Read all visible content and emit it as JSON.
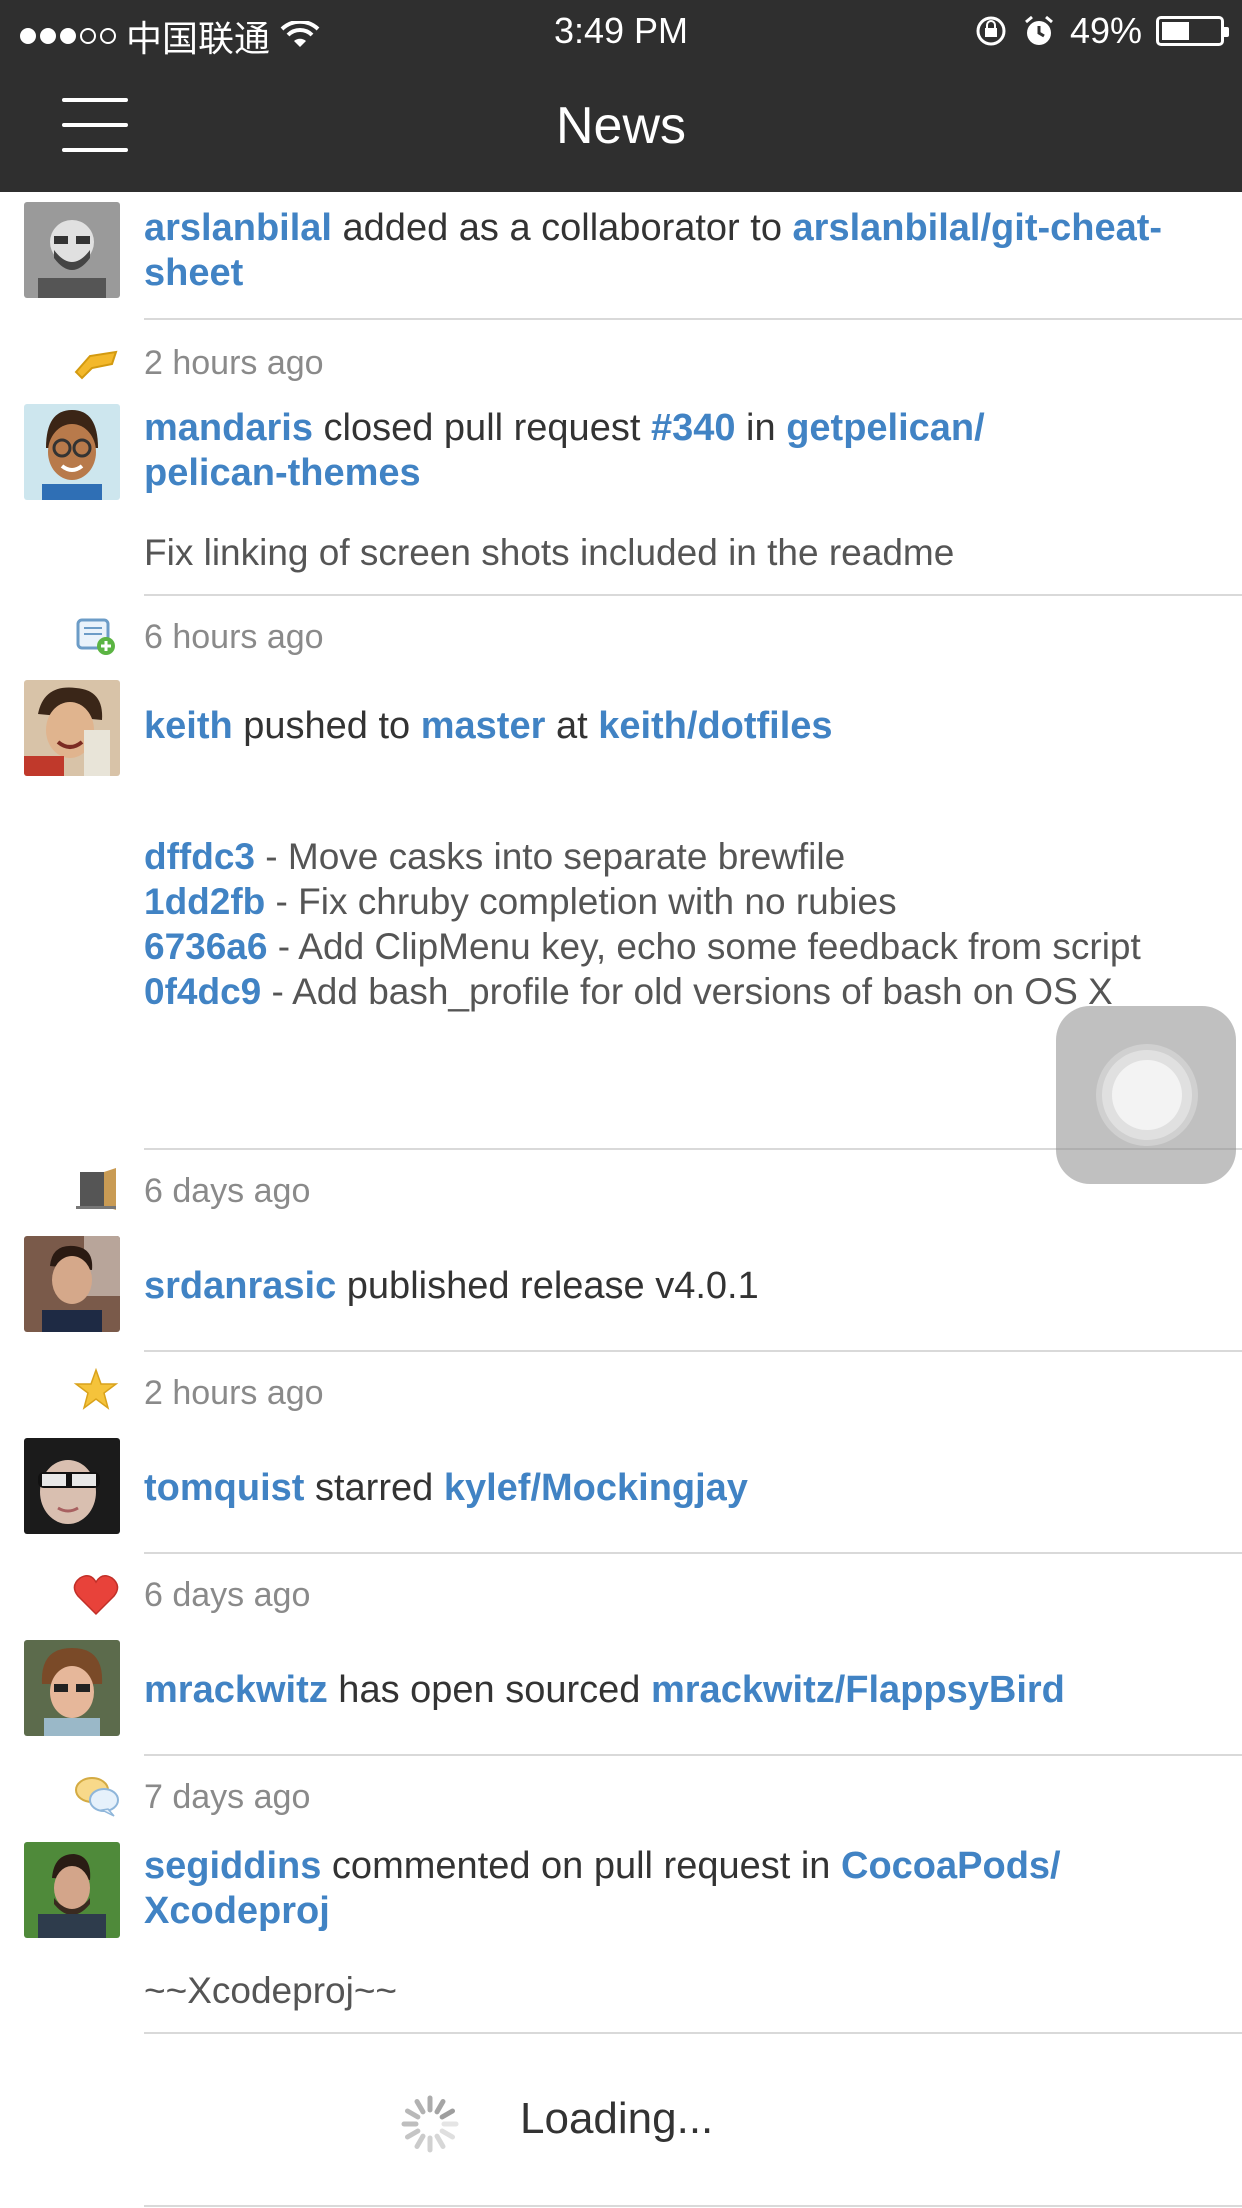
{
  "status_bar": {
    "carrier": "中国联通",
    "time": "3:49 PM",
    "battery": "49%",
    "battery_level": 0.49
  },
  "nav": {
    "title": "News",
    "menu_icon": "hamburger-menu-icon"
  },
  "feed": [
    {
      "icon": "none",
      "time": "",
      "actor": "arslanbilal",
      "action1": " added as a collaborator to ",
      "target": "arslanbilal/git-cheat-sheet",
      "body": ""
    },
    {
      "icon": "pull-request-hand-icon",
      "time": "2 hours ago",
      "actor": "mandaris",
      "action1": " closed pull request ",
      "pr": "#340",
      "action2": " in ",
      "target": "getpelican/pelican-themes",
      "body": "Fix linking of screen shots included in the readme"
    },
    {
      "icon": "push-scroll-icon",
      "time": "6 hours ago",
      "actor": "keith",
      "action1": " pushed to ",
      "branch": "master",
      "action2": " at ",
      "target": "keith/dotfiles",
      "commits": [
        {
          "sha": "dffdc3",
          "msg": " - Move casks into separate brewfile"
        },
        {
          "sha": "1dd2fb",
          "msg": " - Fix chruby completion with no rubies"
        },
        {
          "sha": "6736a6",
          "msg": " - Add ClipMenu key, echo some feedback from script"
        },
        {
          "sha": "0f4dc9",
          "msg": " - Add bash_profile for old versions of bash on OS X"
        }
      ]
    },
    {
      "icon": "release-door-icon",
      "time": "6 days ago",
      "actor": "srdanrasic",
      "action1": " published release v4.0.1"
    },
    {
      "icon": "star-icon",
      "time": "2 hours ago",
      "actor": "tomquist",
      "action1": " starred ",
      "target": "kylef/Mockingjay"
    },
    {
      "icon": "heart-icon",
      "time": "6 days ago",
      "actor": "mrackwitz",
      "action1": " has open sourced ",
      "target": "mrackwitz/FlappsyBird"
    },
    {
      "icon": "comment-bubbles-icon",
      "time": "7 days ago",
      "actor": "segiddins",
      "action1": " commented on pull request  in ",
      "target": "CocoaPods/Xcodeproj",
      "body": "~~Xcodeproj~~"
    }
  ],
  "loading": {
    "label": "Loading..."
  },
  "colors": {
    "link": "#4183c4",
    "bar": "#2f2f2f",
    "meta": "#8a8a8a"
  }
}
